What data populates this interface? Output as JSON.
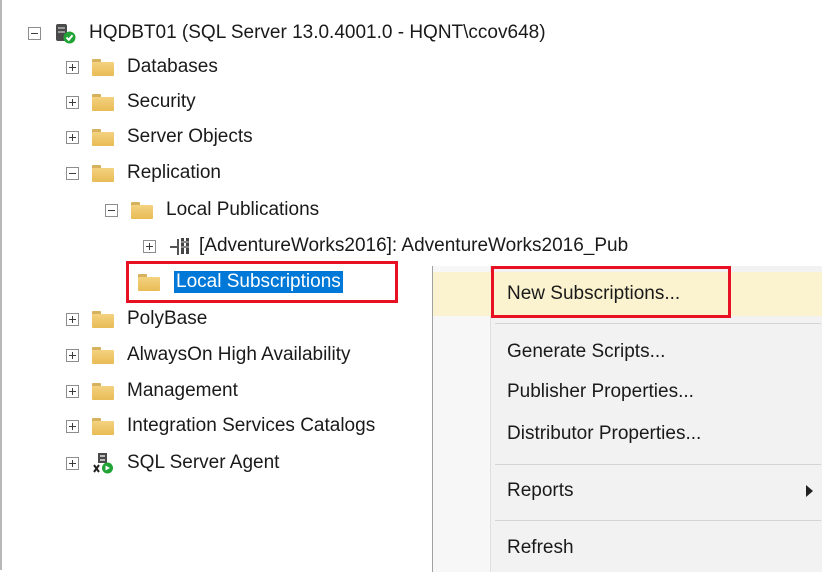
{
  "tree": {
    "server": "HQDBT01 (SQL Server 13.0.4001.0 - HQNT\\ccov648)",
    "databases": "Databases",
    "security": "Security",
    "server_objects": "Server Objects",
    "replication": "Replication",
    "local_publications": "Local Publications",
    "publication": "[AdventureWorks2016]: AdventureWorks2016_Pub",
    "local_subscriptions": "Local Subscriptions",
    "polybase": "PolyBase",
    "alwayson": "AlwaysOn High Availability",
    "management": "Management",
    "integration_services": "Integration Services Catalogs",
    "sql_agent": "SQL Server Agent"
  },
  "context_menu": {
    "new_subscriptions": "New Subscriptions...",
    "generate_scripts": "Generate Scripts...",
    "publisher_properties": "Publisher Properties...",
    "distributor_properties": "Distributor Properties...",
    "reports": "Reports",
    "refresh": "Refresh"
  }
}
